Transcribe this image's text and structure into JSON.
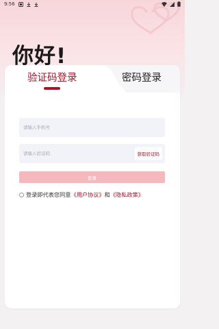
{
  "status_bar": {
    "time": "9:56"
  },
  "greeting": "你好!",
  "tabs": [
    {
      "label": "验证码登录",
      "active": true
    },
    {
      "label": "密码登录",
      "active": false
    }
  ],
  "form": {
    "phone_placeholder": "请输入手机号",
    "code_placeholder": "请输入验证码",
    "get_code_label": "获取验证码",
    "login_label": "登录"
  },
  "agreement": {
    "prefix": "登录即代表您同意",
    "user_agreement": "《用户协议》",
    "and": "和",
    "privacy_policy": "《隐私政策》"
  },
  "colors": {
    "accent": "#a01a2a",
    "login_button": "#f5b8bf",
    "hero_pink": "#f7d6da",
    "input_bg": "#f1f3f8"
  }
}
